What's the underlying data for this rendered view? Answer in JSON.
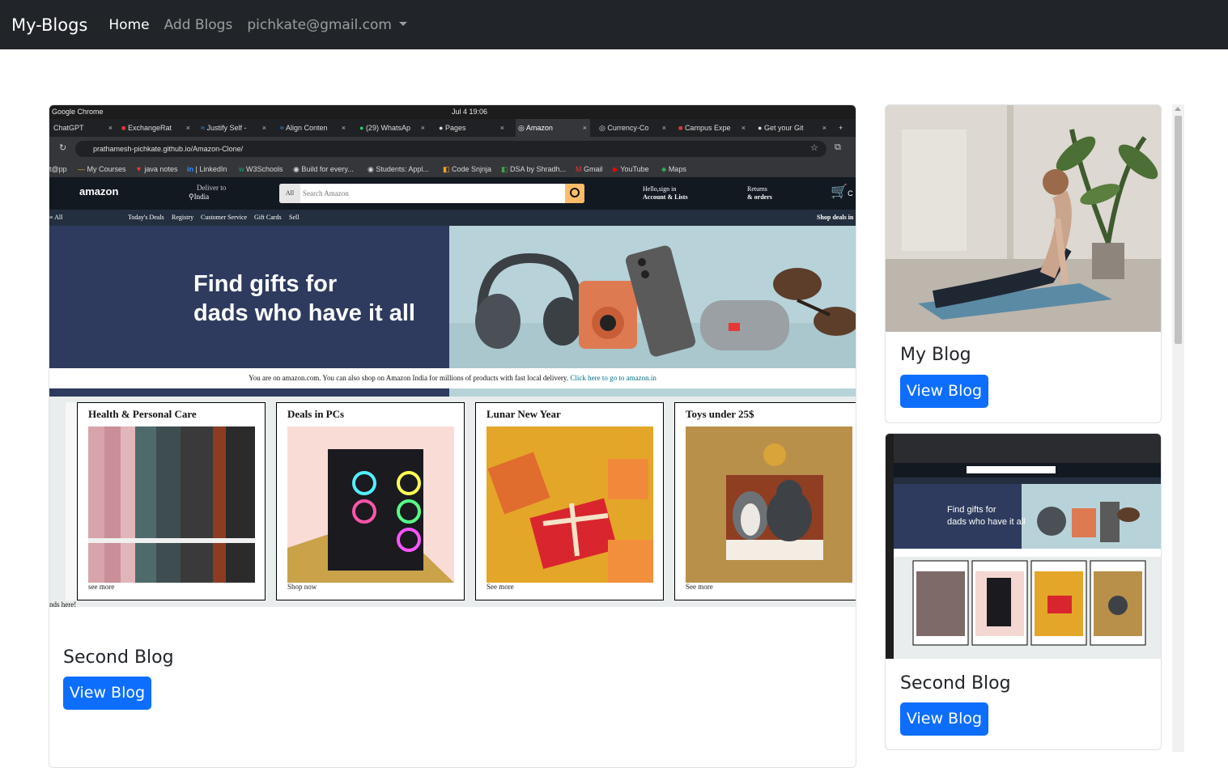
{
  "navbar": {
    "brand": "My-Blogs",
    "home": "Home",
    "add_blogs": "Add Blogs",
    "user": "pichkate@gmail.com"
  },
  "main_post": {
    "title": "Second Blog",
    "button": "View Blog",
    "screenshot": {
      "os_app": "Google Chrome",
      "os_clock": "Jul 4  19:06",
      "tabs": [
        "ChatGPT",
        "ExchangeRat",
        "Justify Self -",
        "Align Conten",
        "(29) WhatsAp",
        "Pages",
        "Amazon",
        "Currency-Co",
        "Campus Expe",
        "Get your Git"
      ],
      "tab_close": "×",
      "new_tab": "+",
      "url": "prathamesh-pichkate.github.io/Amazon-Clone/",
      "bookmarks": [
        "t@pp",
        "My Courses",
        "java notes",
        "| LinkedIn",
        "W3Schools",
        "Build for every...",
        "Students: Appl...",
        "Code Snjnja",
        "DSA by Shradh...",
        "Gmail",
        "YouTube",
        "Maps"
      ],
      "amazon": {
        "logo": "amazon",
        "deliver_label": "Deliver to",
        "deliver_place": "India",
        "search_category": "All",
        "search_placeholder": "Search Amazon",
        "account_line1": "Hello,sign in",
        "account_line2": "Account & Lists",
        "orders_line1": "Returns",
        "orders_line2": "& orders",
        "cart_glyph": "C",
        "subnav_all": "≡ All",
        "subnav_items": [
          "Today's Deals",
          "Registry",
          "Customer Service",
          "Gift Cards",
          "Sell"
        ],
        "subnav_right": "Shop deals in",
        "hero_title": "Find gifts for\ndads who have it all",
        "notice_text": "You are on amazon.com. You can also shop on Amazon India for millions of products with fast local delivery.",
        "notice_link": "Click here to go to amazon.in",
        "boxes": [
          {
            "title": "Health & Personal Care",
            "link": "see more"
          },
          {
            "title": "Deals in PCs",
            "link": "Shop now"
          },
          {
            "title": "Lunar New Year",
            "link": "See more"
          },
          {
            "title": "Toys under 25$",
            "link": "See more"
          }
        ],
        "footer_fragment": "nds here!"
      }
    }
  },
  "side_posts": [
    {
      "title": "My Blog",
      "button": "View Blog",
      "image": "woman doing yoga cobra pose"
    },
    {
      "title": "Second Blog",
      "button": "View Blog",
      "image": "amazon clone screenshot thumbnail"
    }
  ],
  "colors": {
    "navbar": "#212529",
    "primary": "#0d6efd",
    "amazon_dark": "#131921",
    "hero_blue": "#2e3b5e"
  }
}
